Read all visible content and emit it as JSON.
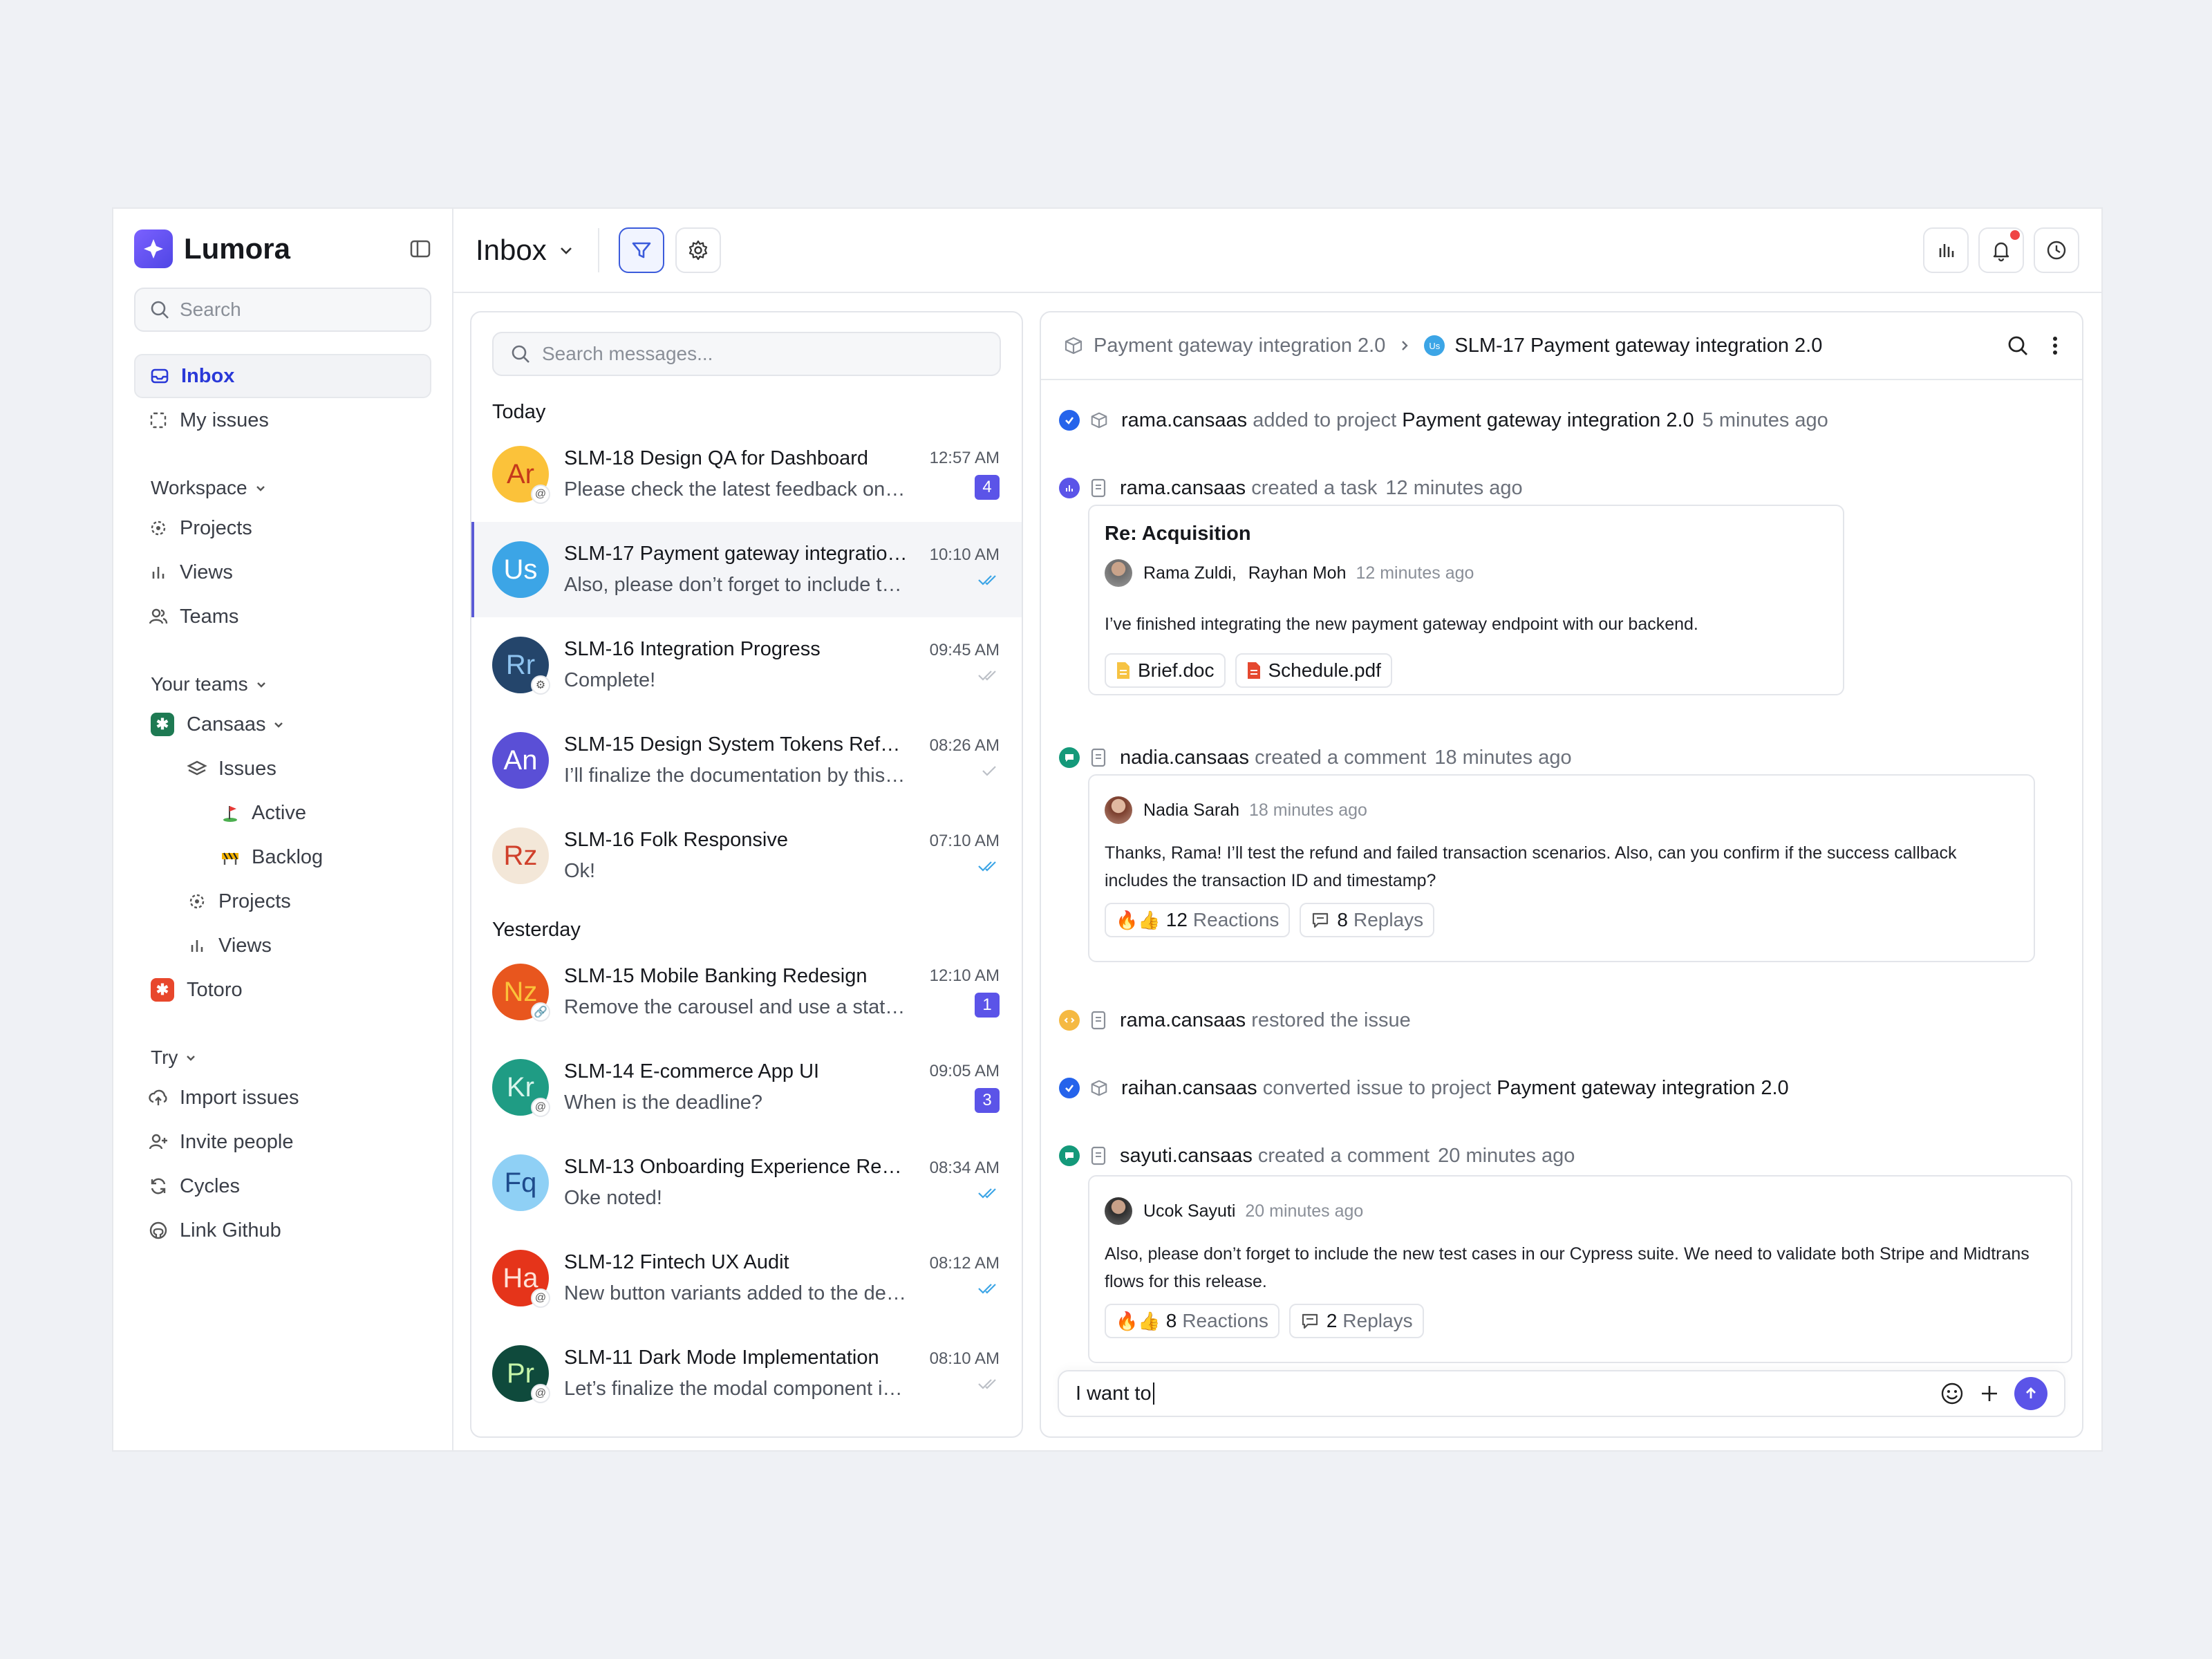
{
  "app": {
    "name": "Lumora"
  },
  "sidebar": {
    "search_placeholder": "Search",
    "nav": [
      {
        "label": "Inbox"
      },
      {
        "label": "My issues"
      }
    ],
    "workspace": {
      "title": "Workspace",
      "items": [
        {
          "label": "Projects"
        },
        {
          "label": "Views"
        },
        {
          "label": "Teams"
        }
      ]
    },
    "your_teams": {
      "title": "Your teams",
      "cansaas": "Cansaas",
      "issues": "Issues",
      "active": "Active",
      "backlog": "Backlog",
      "projects": "Projects",
      "views": "Views",
      "totoro": "Totoro"
    },
    "try": {
      "title": "Try",
      "items": [
        {
          "label": "Import issues"
        },
        {
          "label": "Invite people"
        },
        {
          "label": "Cycles"
        },
        {
          "label": "Link Github"
        }
      ]
    }
  },
  "topbar": {
    "title": "Inbox"
  },
  "list": {
    "search_placeholder": "Search messages...",
    "today_label": "Today",
    "yesterday_label": "Yesterday",
    "today": [
      {
        "initials": "Ar",
        "title": "SLM-18 Design QA for Dashboard",
        "preview": "Please check the latest feedback on the dashboard",
        "time": "12:57 AM",
        "count": "4"
      },
      {
        "initials": "Us",
        "title": "SLM-17 Payment gateway integration 2.0",
        "preview": "Also, please don’t forget to include the new test",
        "time": "10:10 AM"
      },
      {
        "initials": "Rr",
        "title": "SLM-16 Integration Progress",
        "preview": "Complete!",
        "time": "09:45 AM"
      },
      {
        "initials": "An",
        "title": "SLM-15 Design System Tokens Refactor",
        "preview": "I’ll finalize the documentation by this Sunday",
        "time": "08:26 AM"
      },
      {
        "initials": "Rz",
        "title": "SLM-16 Folk Responsive",
        "preview": "Ok!",
        "time": "07:10 AM"
      }
    ],
    "yesterday": [
      {
        "initials": "Nz",
        "title": "SLM-15 Mobile Banking Redesign",
        "preview": "Remove the carousel and use a static banner",
        "time": "12:10 AM",
        "count": "1"
      },
      {
        "initials": "Kr",
        "title": "SLM-14 E-commerce App UI",
        "preview": "When is the deadline?",
        "time": "09:05 AM",
        "count": "3"
      },
      {
        "initials": "Fq",
        "title": "SLM-13 Onboarding Experience Revamp",
        "preview": "Oke noted!",
        "time": "08:34 AM"
      },
      {
        "initials": "Ha",
        "title": "SLM-12 Fintech UX Audit",
        "preview": "New button variants added to the design system",
        "time": "08:12 AM"
      },
      {
        "initials": "Pr",
        "title": "SLM-11 Dark Mode Implementation",
        "preview": "Let’s finalize the modal component interactions",
        "time": "08:10 AM"
      }
    ]
  },
  "detail": {
    "crumb_project": "Payment gateway integration 2.0",
    "crumb_avatar": "Us",
    "crumb_issue": "SLM-17 Payment gateway integration 2.0",
    "activity": {
      "a1": {
        "user": "rama.cansaas",
        "action": "added to project",
        "target": "Payment gateway integration 2.0",
        "time": "5 minutes ago"
      },
      "a2": {
        "user": "rama.cansaas",
        "action": "created a task",
        "time": "12 minutes ago"
      },
      "a3": {
        "user": "nadia.cansaas",
        "action": "created a comment",
        "time": "18 minutes ago"
      },
      "a4": {
        "user": "rama.cansaas",
        "action": "restored the issue"
      },
      "a5": {
        "user": "raihan.cansaas",
        "action": "converted issue to project",
        "target": "Payment gateway integration 2.0"
      },
      "a6": {
        "user": "sayuti.cansaas",
        "action": "created a comment",
        "time": "20 minutes ago"
      }
    },
    "task_card": {
      "title": "Re: Acquisition",
      "author1": "Rama Zuldi,",
      "author2": "Rayhan Moh",
      "time": "12 minutes ago",
      "text": "I’ve finished integrating the new payment gateway endpoint with our backend.",
      "file1": "Brief.doc",
      "file2": "Schedule.pdf"
    },
    "comment1": {
      "author": "Nadia Sarah",
      "time": "18 minutes ago",
      "text": "Thanks, Rama! I’ll test the refund and failed transaction scenarios. Also, can you confirm if the success callback includes the transaction ID and timestamp?",
      "reactions_count": "12",
      "reactions_label": "Reactions",
      "replies_count": "8",
      "replies_label": "Replays"
    },
    "comment2": {
      "author": "Ucok Sayuti",
      "time": "20 minutes ago",
      "text": "Also, please don’t forget to include the new test cases in our Cypress suite. We need to validate both Stripe and Midtrans flows for this release.",
      "reactions_count": "8",
      "reactions_label": "Reactions",
      "replies_count": "2",
      "replies_label": "Replays"
    },
    "composer_value": "I want to"
  },
  "colors": {
    "accent": "#5b54e8",
    "brand": "#6d5cf6",
    "link": "#2a39d8"
  }
}
